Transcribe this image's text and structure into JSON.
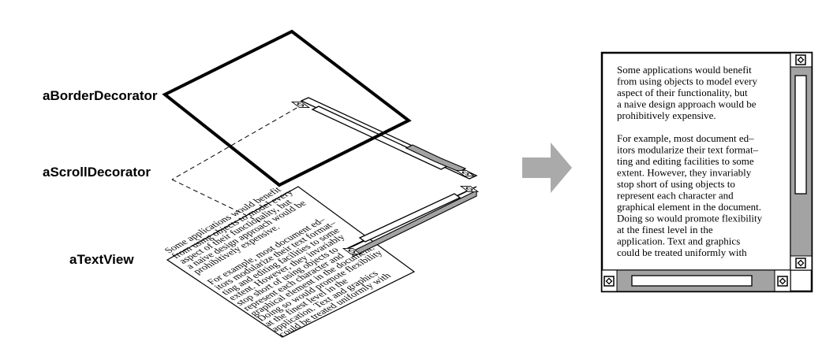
{
  "labels": {
    "border_decorator": "aBorderDecorator",
    "scroll_decorator": "aScrollDecorator",
    "text_view": "aTextView"
  },
  "arrow": {
    "color": "#aaaaaa"
  },
  "colors": {
    "scroll_gray": "#a3a3a3",
    "line": "#000000"
  },
  "text_view_lines": [
    "Some applications would benefit",
    "from using objects to model every",
    "aspect of their functionality, but",
    "a naive design approach would be",
    "prohibitively expensive.",
    "",
    "For example, most document ed–",
    "itors modularize their text format–",
    "ting and editing facilities to some",
    "extent. However, they invariably",
    "stop short of using objects to",
    "represent each character and",
    "graphical element in the document.",
    "Doing so would promote flexibility",
    "at the finest level in the",
    "application.  Text and graphics",
    "could be treated uniformly with"
  ],
  "window_lines": [
    "Some applications would benefit",
    "from using objects to model every",
    "aspect of their functionality, but",
    "a naive design approach would be",
    "prohibitively expensive.",
    "",
    "For example, most document ed–",
    "itors modularize their text format–",
    "ting and editing facilities to some",
    "extent. However, they invariably",
    "stop short of using objects to",
    "represent each character and",
    "graphical element in the document.",
    "Doing so would promote flexibility",
    "at the finest level in the",
    "application.  Text and graphics",
    "could be treated uniformly with"
  ]
}
